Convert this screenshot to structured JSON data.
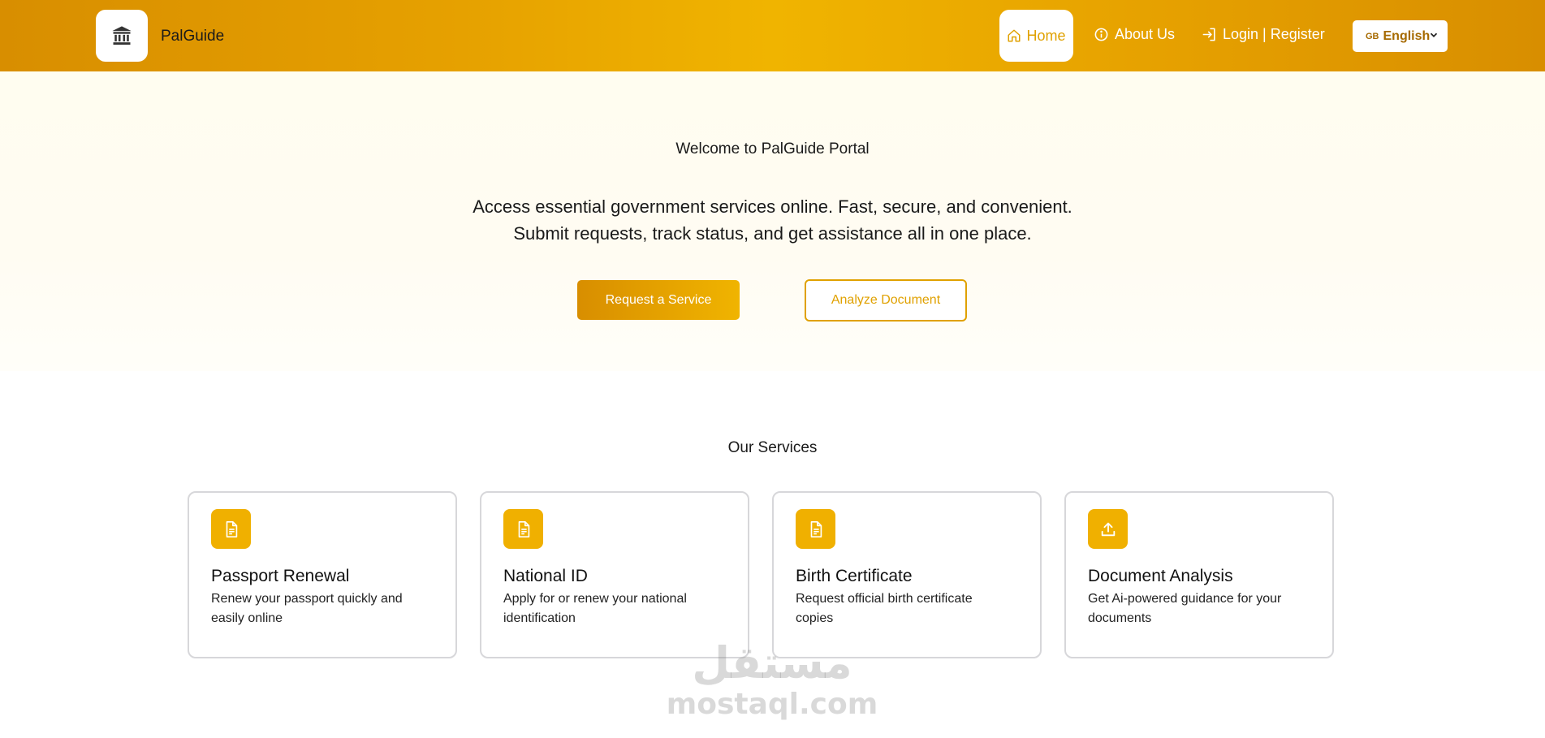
{
  "header": {
    "brand": "PalGuide",
    "nav": {
      "home": "Home",
      "about": "About Us",
      "login": "Login | Register"
    },
    "language": {
      "flag": "GB",
      "selected": "English"
    }
  },
  "hero": {
    "title": "Welcome to PalGuide Portal",
    "subtitle_line1": "Access essential government services online. Fast, secure, and convenient.",
    "subtitle_line2": "Submit requests, track status, and get assistance all in one place.",
    "primary_button": "Request a Service",
    "secondary_button": "Analyze Document"
  },
  "services": {
    "title": "Our Services",
    "items": [
      {
        "title": "Passport Renewal",
        "description": "Renew your passport quickly and easily online",
        "icon": "document-icon"
      },
      {
        "title": "National ID",
        "description": "Apply for or renew your national identification",
        "icon": "document-icon"
      },
      {
        "title": "Birth Certificate",
        "description": "Request official birth certificate copies",
        "icon": "document-icon"
      },
      {
        "title": "Document Analysis",
        "description": "Get Ai-powered guidance for your documents",
        "icon": "upload-icon"
      }
    ]
  },
  "watermark": {
    "arabic": "مستقل",
    "latin": "mostaql.com"
  },
  "colors": {
    "accent": "#f0b000",
    "accent_dark": "#d88e00",
    "hero_bg": "#fffdf0",
    "card_border": "#d7d7da"
  }
}
